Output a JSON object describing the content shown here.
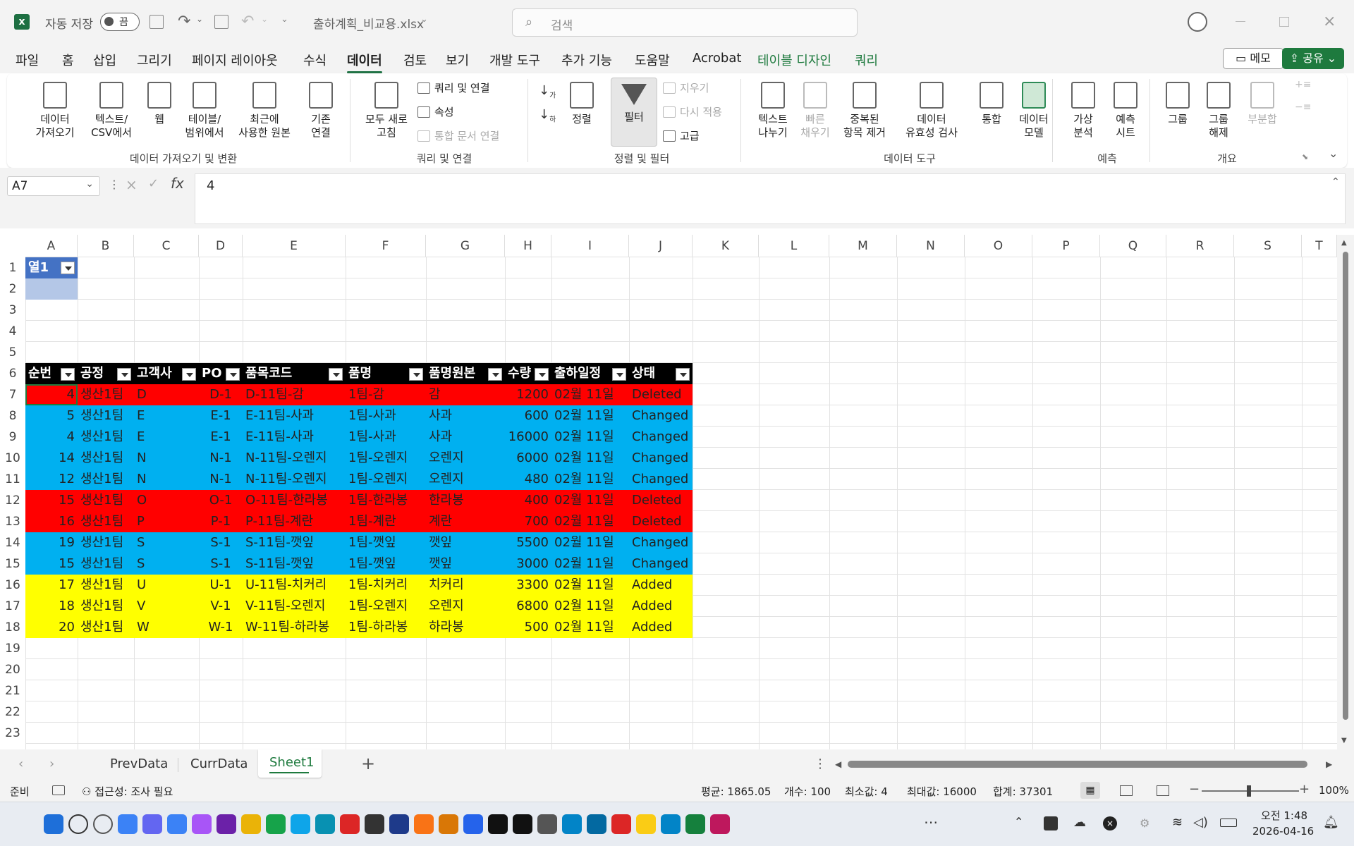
{
  "titlebar": {
    "autosave_label": "자동 저장",
    "autosave_state": "끔",
    "filename": "출하계획_비교용.xlsx",
    "search_placeholder": "검색"
  },
  "menu": {
    "items": [
      "파일",
      "홈",
      "삽입",
      "그리기",
      "페이지 레이아웃",
      "수식",
      "데이터",
      "검토",
      "보기",
      "개발 도구",
      "추가 기능",
      "도움말",
      "Acrobat",
      "테이블 디자인",
      "쿼리"
    ],
    "active": "데이터",
    "memo": "메모",
    "share": "공유"
  },
  "ribbon": {
    "get_data": "데이터\n가져오기",
    "text_csv": "텍스트/\nCSV에서",
    "web": "웹",
    "table_range": "테이블/\n범위에서",
    "recent": "최근에\n사용한 원본",
    "existing": "기존\n연결",
    "group1": "데이터 가져오기 및 변환",
    "refresh_all": "모두 새로\n고침",
    "queries_conn": "쿼리 및 연결",
    "properties": "속성",
    "edit_links": "통합 문서 연결",
    "group2": "쿼리 및 연결",
    "sort": "정렬",
    "filter": "필터",
    "clear": "지우기",
    "reapply": "다시 적용",
    "advanced": "고급",
    "group3": "정렬 및 필터",
    "text_to_col": "텍스트\n나누기",
    "flash_fill": "빠른\n채우기",
    "remove_dup": "중복된\n항목 제거",
    "validation": "데이터\n유효성 검사",
    "consolidate": "통합",
    "data_model": "데이터\n모델",
    "group4": "데이터 도구",
    "whatif": "가상\n분석",
    "forecast": "예측\n시트",
    "group5": "예측",
    "group_btn": "그룹",
    "ungroup": "그룹\n해제",
    "subtotal": "부분합",
    "group6": "개요"
  },
  "formula_bar": {
    "name_box": "A7",
    "value": "4"
  },
  "columns": [
    "A",
    "B",
    "C",
    "D",
    "E",
    "F",
    "G",
    "H",
    "I",
    "J",
    "K",
    "L",
    "M",
    "N",
    "O",
    "P",
    "Q",
    "R",
    "S",
    "T"
  ],
  "rows": [
    "1",
    "2",
    "3",
    "4",
    "5",
    "6",
    "7",
    "8",
    "9",
    "10",
    "11",
    "12",
    "13",
    "14",
    "15",
    "16",
    "17",
    "18",
    "19",
    "20",
    "21",
    "22",
    "23"
  ],
  "table1": {
    "header": "열1"
  },
  "table2": {
    "headers": [
      "순번",
      "공정",
      "고객사",
      "PO",
      "품목코드",
      "품명",
      "품명원본",
      "수량",
      "출하일정",
      "상태"
    ],
    "rows": [
      {
        "n": "4",
        "proc": "생산1팀",
        "cust": "D",
        "po": "D-1",
        "code": "D-11팀-감",
        "name": "1팀-감",
        "orig": "감",
        "qty": "1200",
        "date": "02월 11일",
        "status": "Deleted"
      },
      {
        "n": "5",
        "proc": "생산1팀",
        "cust": "E",
        "po": "E-1",
        "code": "E-11팀-사과",
        "name": "1팀-사과",
        "orig": "사과",
        "qty": "600",
        "date": "02월 11일",
        "status": "Changed"
      },
      {
        "n": "4",
        "proc": "생산1팀",
        "cust": "E",
        "po": "E-1",
        "code": "E-11팀-사과",
        "name": "1팀-사과",
        "orig": "사과",
        "qty": "16000",
        "date": "02월 11일",
        "status": "Changed"
      },
      {
        "n": "14",
        "proc": "생산1팀",
        "cust": "N",
        "po": "N-1",
        "code": "N-11팀-오렌지",
        "name": "1팀-오렌지",
        "orig": "오렌지",
        "qty": "6000",
        "date": "02월 11일",
        "status": "Changed"
      },
      {
        "n": "12",
        "proc": "생산1팀",
        "cust": "N",
        "po": "N-1",
        "code": "N-11팀-오렌지",
        "name": "1팀-오렌지",
        "orig": "오렌지",
        "qty": "480",
        "date": "02월 11일",
        "status": "Changed"
      },
      {
        "n": "15",
        "proc": "생산1팀",
        "cust": "O",
        "po": "O-1",
        "code": "O-11팀-한라봉",
        "name": "1팀-한라봉",
        "orig": "한라봉",
        "qty": "400",
        "date": "02월 11일",
        "status": "Deleted"
      },
      {
        "n": "16",
        "proc": "생산1팀",
        "cust": "P",
        "po": "P-1",
        "code": "P-11팀-계란",
        "name": "1팀-계란",
        "orig": "계란",
        "qty": "700",
        "date": "02월 11일",
        "status": "Deleted"
      },
      {
        "n": "19",
        "proc": "생산1팀",
        "cust": "S",
        "po": "S-1",
        "code": "S-11팀-깻잎",
        "name": "1팀-깻잎",
        "orig": "깻잎",
        "qty": "5500",
        "date": "02월 11일",
        "status": "Changed"
      },
      {
        "n": "15",
        "proc": "생산1팀",
        "cust": "S",
        "po": "S-1",
        "code": "S-11팀-깻잎",
        "name": "1팀-깻잎",
        "orig": "깻잎",
        "qty": "3000",
        "date": "02월 11일",
        "status": "Changed"
      },
      {
        "n": "17",
        "proc": "생산1팀",
        "cust": "U",
        "po": "U-1",
        "code": "U-11팀-치커리",
        "name": "1팀-치커리",
        "orig": "치커리",
        "qty": "3300",
        "date": "02월 11일",
        "status": "Added"
      },
      {
        "n": "18",
        "proc": "생산1팀",
        "cust": "V",
        "po": "V-1",
        "code": "V-11팀-오렌지",
        "name": "1팀-오렌지",
        "orig": "오렌지",
        "qty": "6800",
        "date": "02월 11일",
        "status": "Added"
      },
      {
        "n": "20",
        "proc": "생산1팀",
        "cust": "W",
        "po": "W-1",
        "code": "W-11팀-하라봉",
        "name": "1팀-하라봉",
        "orig": "하라봉",
        "qty": "500",
        "date": "02월 11일",
        "status": "Added"
      }
    ],
    "status_colors": {
      "Deleted": "#ff0000",
      "Changed": "#00b0f0",
      "Added": "#ffff00"
    }
  },
  "sheet_tabs": [
    "PrevData",
    "CurrData",
    "Sheet1"
  ],
  "active_sheet": "Sheet1",
  "status": {
    "ready": "준비",
    "accessibility": "접근성: 조사 필요",
    "average": "평균: 1865.05",
    "count": "개수: 100",
    "min": "최소값: 4",
    "max": "최대값: 16000",
    "sum": "합계: 37301",
    "zoom": "100%"
  },
  "taskbar": {
    "time": "오전 1:48",
    "date": "2026-04-16"
  },
  "colors": {
    "accent": "#217346",
    "table_header": "#000000"
  }
}
